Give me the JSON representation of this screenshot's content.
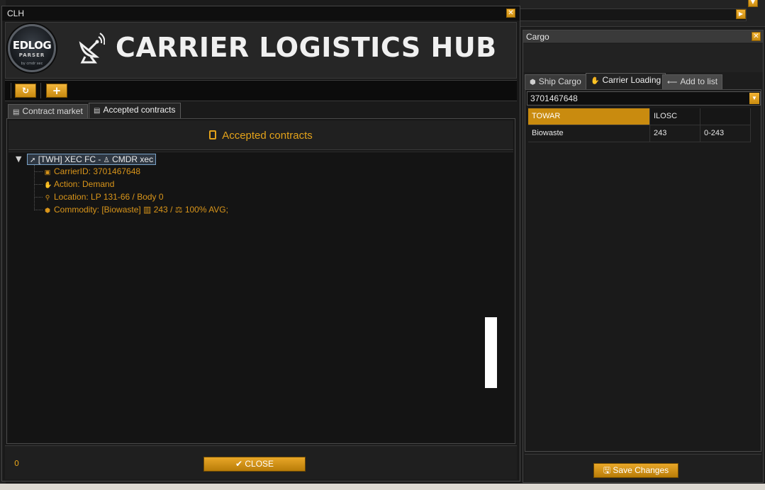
{
  "clh_window": {
    "title": "CLH",
    "close_glyph": "✕",
    "logo": {
      "main": "EDLOG",
      "sub": "PARSER",
      "byline": "by cmdr xec"
    },
    "header_icon": "satellite-dish-icon",
    "header_title": "CARRIER LOGISTICS HUB",
    "toolbar": {
      "refresh_glyph": "↻",
      "add_glyph": "+"
    },
    "tabs": [
      {
        "label": "Contract market",
        "icon": "market-icon",
        "active": false
      },
      {
        "label": "Accepted contracts",
        "icon": "clipboard-icon",
        "active": true
      }
    ],
    "panel_title": "Accepted contracts",
    "tree": {
      "root_label": "[TWH] XEC FC -",
      "root_commander": "CMDR xec",
      "children": [
        {
          "icon": "id-card-icon",
          "glyph": "▣",
          "text": "CarrierID: 3701467648"
        },
        {
          "icon": "hand-icon",
          "glyph": "✋",
          "text": "Action: Demand"
        },
        {
          "icon": "location-pin-icon",
          "glyph": "⚲",
          "text": "Location: LP 131-66 / Body 0"
        },
        {
          "icon": "box-icon",
          "glyph": "⬢",
          "text": "Commodity: [Biowaste] ▥ 243 / ⚖ 100% AVG;"
        }
      ]
    },
    "footer": {
      "count": "0",
      "close_label": "CLOSE",
      "close_glyph": "✔"
    }
  },
  "cargo_window": {
    "title": "Cargo",
    "tabs": [
      {
        "label": "Ship Cargo",
        "icon": "box-icon",
        "active": false
      },
      {
        "label": "Carrier Loading",
        "icon": "hand-icon",
        "active": true
      },
      {
        "label": "Add to list",
        "icon": "arrow-left-icon",
        "active": false
      }
    ],
    "carrier_id": "3701467648",
    "grid": {
      "headers": [
        "TOWAR",
        "ILOSC",
        ""
      ],
      "rows": [
        [
          "Biowaste",
          "243",
          "0-243"
        ]
      ]
    },
    "save_label": "Save Changes",
    "save_glyph": "🖫"
  },
  "colors": {
    "accent": "#c98b0f",
    "accent_text": "#e3a21a",
    "background": "#1a1a1a"
  }
}
